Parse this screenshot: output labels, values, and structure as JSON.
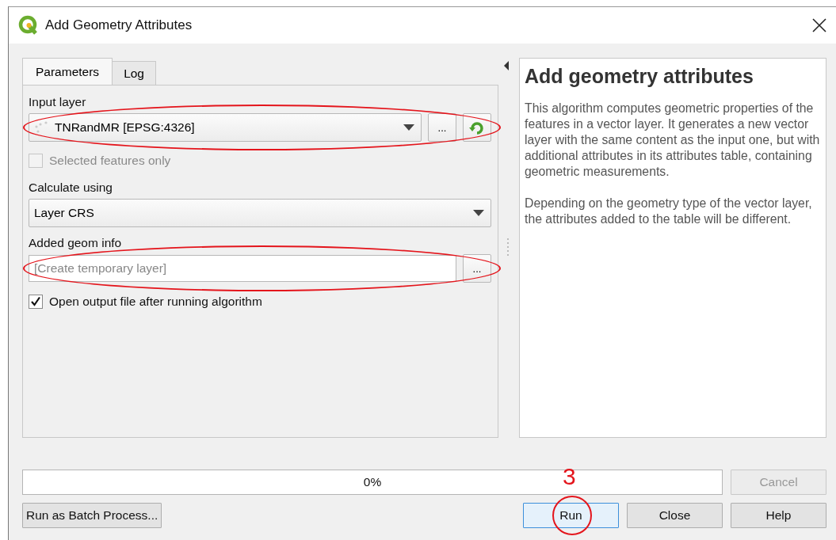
{
  "window": {
    "title": "Add Geometry Attributes"
  },
  "tabs": [
    {
      "label": "Parameters",
      "selected": true
    },
    {
      "label": "Log",
      "selected": false
    }
  ],
  "parameters": [
    {
      "kind": "label",
      "text": "Input layer"
    },
    {
      "kind": "layer-combo",
      "value": "TNRandMR [EPSG:4326]",
      "button": "...",
      "annotated": true
    },
    {
      "kind": "checkbox",
      "label": "Selected features only",
      "checked": false,
      "disabled": true
    },
    {
      "kind": "label",
      "text": "Calculate using"
    },
    {
      "kind": "combo",
      "value": "Layer CRS"
    },
    {
      "kind": "label",
      "text": "Added geom info"
    },
    {
      "kind": "output",
      "placeholder": "[Create temporary layer]",
      "button": "...",
      "annotated": true
    },
    {
      "kind": "checkbox",
      "label": "Open output file after running algorithm",
      "checked": true,
      "disabled": false
    }
  ],
  "help": {
    "title": "Add geometry attributes",
    "paragraphs": [
      "This algorithm computes geometric properties of the features in a vector layer. It generates a new vector layer with the same content as the input one, but with additional attributes in its attributes table, containing geometric measurements.",
      "Depending on the geometry type of the vector layer, the attributes added to the table will be different."
    ]
  },
  "progress": {
    "level": 0,
    "text": "0%"
  },
  "cancel_button": {
    "label": "Cancel",
    "disabled": true
  },
  "batch_button": {
    "label": "Run as Batch Process..."
  },
  "buttons": [
    {
      "label": "Run",
      "default": true,
      "annotation": "3"
    },
    {
      "label": "Close",
      "default": false
    },
    {
      "label": "Help",
      "default": false
    }
  ]
}
